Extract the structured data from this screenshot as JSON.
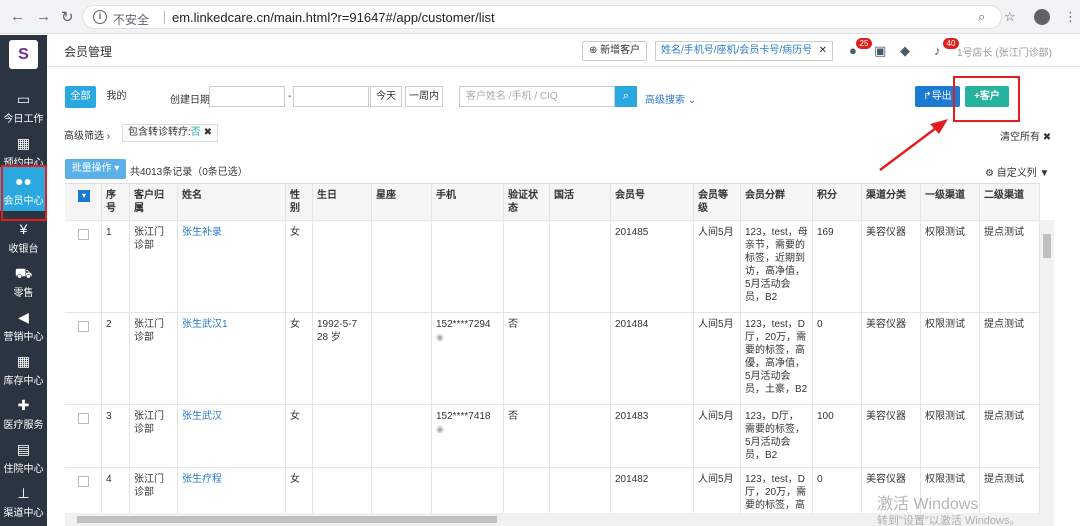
{
  "browser": {
    "insecure": "不安全",
    "url": "em.linkedcare.cn/main.html?r=91647#/app/customer/list"
  },
  "sidebar": {
    "logo": "S",
    "items": [
      {
        "label": "今日工作",
        "icon": "monitor-icon"
      },
      {
        "label": "预约中心",
        "icon": "calendar-icon"
      },
      {
        "label": "会员中心",
        "icon": "users-icon"
      },
      {
        "label": "收银台",
        "icon": "yen-icon"
      },
      {
        "label": "零售",
        "icon": "cart-icon"
      },
      {
        "label": "营销中心",
        "icon": "megaphone-icon"
      },
      {
        "label": "库存中心",
        "icon": "grid-icon"
      },
      {
        "label": "医疗服务",
        "icon": "medkit-icon"
      },
      {
        "label": "住院中心",
        "icon": "building-icon"
      },
      {
        "label": "渠道中心",
        "icon": "network-icon"
      }
    ]
  },
  "header": {
    "title": "会员管理",
    "new_customer": "新增客户",
    "search_placeholder": "姓名/手机号/座机/会员卡号/病历号",
    "badge1": "25",
    "badge2": "40",
    "user": "1号店长 (张江门诊部)"
  },
  "filters": {
    "tab_all": "全部",
    "tab_mine": "我的",
    "created_label": "创建日期",
    "dash": "-",
    "today": "今天",
    "week": "一周内",
    "search_placeholder": "客户姓名 /手机 / CIQ",
    "advanced": "高级搜索",
    "export": "导出",
    "add": "客户"
  },
  "advanced": {
    "label": "高级筛选",
    "chip_label": "包含转诊转疗:",
    "chip_value": "否",
    "clear": "清空所有"
  },
  "list": {
    "batch": "批量操作",
    "total": "共4013条记录（0条已选）",
    "custom_cols": "自定义列"
  },
  "table": {
    "headers": [
      "序号",
      "客户归属",
      "姓名",
      "性别",
      "生日",
      "星座",
      "手机",
      "验证状态",
      "国活",
      "会员号",
      "会员等级",
      "会员分群",
      "积分",
      "渠道分类",
      "一级渠道",
      "二级渠道"
    ],
    "rows": [
      {
        "no": "1",
        "belong": "张江门诊部",
        "name": "张生补录",
        "gender": "女",
        "birthday": "",
        "phone": "",
        "verified": "",
        "member_no": "201485",
        "level": "人间5月",
        "group": "123，test，母亲节，需要的标签，近期到访，高净值，5月活动会员，B2",
        "points": "169",
        "channel": "美容仪器",
        "ch1": "权限测试",
        "ch2": "提点测试"
      },
      {
        "no": "2",
        "belong": "张江门诊部",
        "name": "张生武汉1",
        "gender": "女",
        "birthday": "1992-5-7 28 岁",
        "phone": "152****7294",
        "verified": "否",
        "member_no": "201484",
        "level": "人间5月",
        "group": "123，test，D厅，20万，需要的标签，高優，高净值，5月活动会员，土豪，B2",
        "points": "0",
        "channel": "美容仪器",
        "ch1": "权限测试",
        "ch2": "提点测试"
      },
      {
        "no": "3",
        "belong": "张江门诊部",
        "name": "张生武汉",
        "gender": "女",
        "birthday": "",
        "phone": "152****7418",
        "verified": "否",
        "member_no": "201483",
        "level": "人间5月",
        "group": "123，D厅，需要的标签，5月活动会员，B2",
        "points": "100",
        "channel": "美容仪器",
        "ch1": "权限测试",
        "ch2": "提点测试"
      },
      {
        "no": "4",
        "belong": "张江门诊部",
        "name": "张生疗程",
        "gender": "女",
        "birthday": "",
        "phone": "",
        "verified": "",
        "member_no": "201482",
        "level": "人间5月",
        "group": "123，test，D厅，20万，需要的标签，高",
        "points": "0",
        "channel": "美容仪器",
        "ch1": "权限测试",
        "ch2": "提点测试"
      }
    ]
  },
  "watermark": {
    "line1": "激活 Windows",
    "line2": "转到\"设置\"以激活 Windows。"
  }
}
